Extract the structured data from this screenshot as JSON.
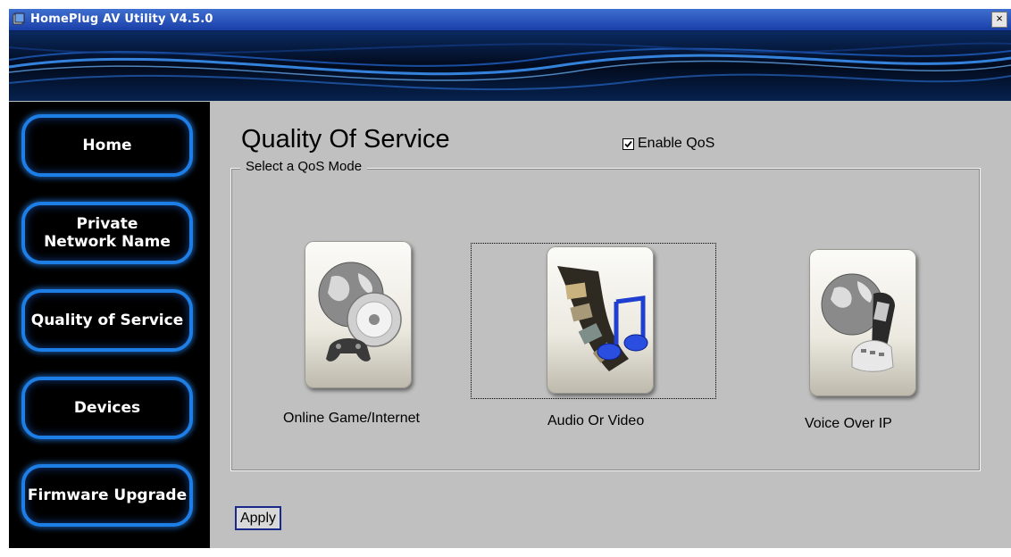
{
  "window": {
    "title": "HomePlug AV Utility V4.5.0",
    "close_label": "×"
  },
  "sidebar": {
    "items": [
      {
        "label": "Home"
      },
      {
        "label_lines": [
          "Private",
          "Network Name"
        ]
      },
      {
        "label": "Quality of Service"
      },
      {
        "label": "Devices"
      },
      {
        "label": "Firmware Upgrade"
      }
    ],
    "selected": "Quality of Service"
  },
  "main": {
    "title": "Quality Of Service",
    "enable_qos": {
      "label": "Enable QoS",
      "checked": true
    },
    "group_label": "Select a QoS Mode",
    "modes": [
      {
        "label": "Online Game/Internet",
        "icon": "game-globe-disc-icon"
      },
      {
        "label": "Audio Or Video",
        "icon": "film-music-icon",
        "focused": true
      },
      {
        "label": "Voice Over IP",
        "icon": "globe-phone-icon"
      }
    ],
    "apply_label": "Apply"
  },
  "colors": {
    "nav_border": "#1d7ee6",
    "window_bg": "#c0c0c0",
    "titlebar": "#1a3fa8"
  }
}
